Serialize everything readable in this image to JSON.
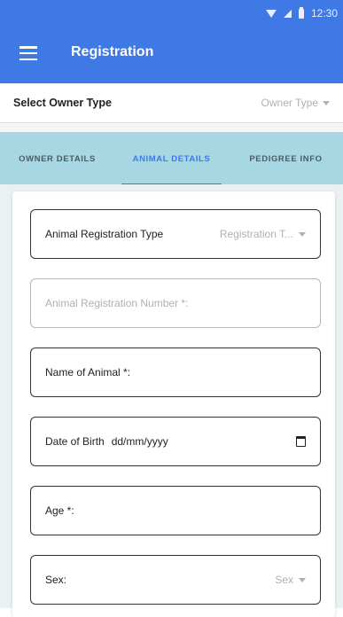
{
  "status": {
    "time": "12:30"
  },
  "appbar": {
    "title": "Registration"
  },
  "owner": {
    "label": "Select Owner Type",
    "selected": "Owner Type"
  },
  "tabs": [
    {
      "label": "OWNER DETAILS"
    },
    {
      "label": "ANIMAL DETAILS"
    },
    {
      "label": "PEDIGREE INFO"
    }
  ],
  "form": {
    "reg_type": {
      "label": "Animal Registration Type",
      "selected": "Registration T..."
    },
    "reg_number": {
      "placeholder": "Animal Registration Number *:"
    },
    "name": {
      "label": "Name of Animal *:"
    },
    "dob": {
      "label": "Date of Birth",
      "value": "dd/mm/yyyy"
    },
    "age": {
      "label": "Age *:"
    },
    "sex": {
      "label": "Sex:",
      "selected": "Sex"
    }
  }
}
